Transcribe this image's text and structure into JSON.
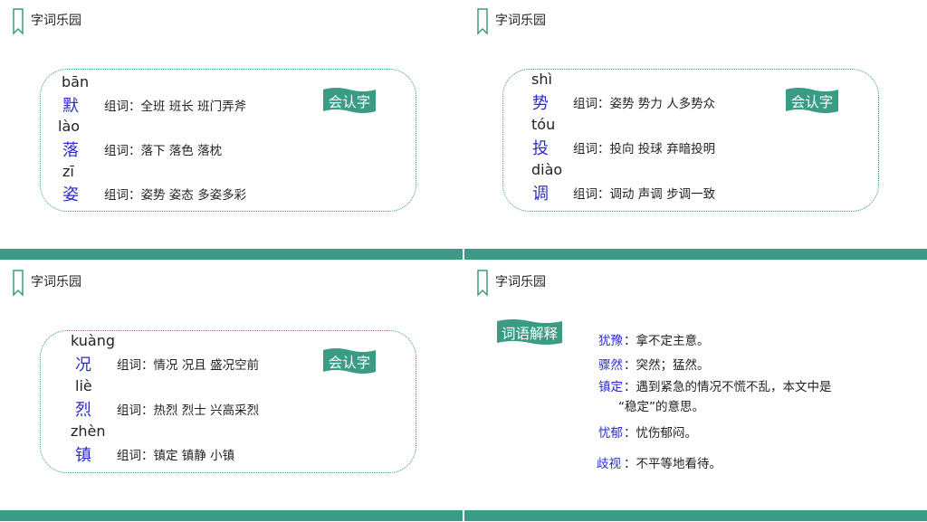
{
  "section_title": "字词乐园",
  "badge_label": "会认字",
  "panel1": {
    "rows": [
      {
        "pinyin": "bān",
        "char": "默",
        "words": "组词：全班  班长  班门弄斧"
      },
      {
        "pinyin": "lào",
        "char": "落",
        "words": "组词：落下  落色  落枕"
      },
      {
        "pinyin": "zī",
        "char": "姿",
        "words": "组词：姿势  姿态  多姿多彩"
      }
    ]
  },
  "panel2": {
    "rows": [
      {
        "pinyin": "shì",
        "char": "势",
        "words": "组词：姿势  势力  人多势众"
      },
      {
        "pinyin": "tóu",
        "char": "投",
        "words": "组词：投向  投球  弃暗投明"
      },
      {
        "pinyin": "diào",
        "char": "调",
        "words": "组词：调动  声调  步调一致"
      }
    ]
  },
  "panel3": {
    "rows": [
      {
        "pinyin": "kuàng",
        "char": "况",
        "words": "组词：情况  况且  盛况空前"
      },
      {
        "pinyin": "liè",
        "char": "烈",
        "words": "组词：热烈  烈士  兴高采烈"
      },
      {
        "pinyin": "zhèn",
        "char": "镇",
        "words": "组词：镇定  镇静  小镇"
      }
    ]
  },
  "panel4": {
    "badge_label": "词语解释",
    "entries": [
      {
        "term": "犹豫",
        "def": "：拿不定主意。"
      },
      {
        "term": "骤然",
        "def": "：突然；猛然。"
      },
      {
        "term": "镇定",
        "def": "：遇到紧急的情况不慌不乱，本文中是",
        "def2": "“稳定”的意思。"
      },
      {
        "term": "忧郁",
        "def": "：忧伤郁闷。"
      },
      {
        "term": "歧视",
        "def": "：不平等地看待。"
      }
    ]
  },
  "colors": {
    "accent": "#3a9c84",
    "hanzi": "#2b2bd0"
  }
}
